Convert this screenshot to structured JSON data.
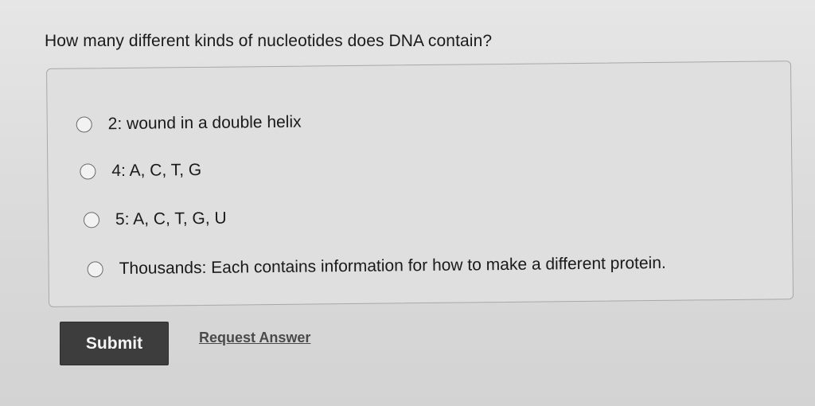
{
  "question": {
    "text": "How many different kinds of nucleotides does DNA contain?"
  },
  "options": [
    {
      "label": "2: wound in a double helix"
    },
    {
      "label": "4: A, C, T, G"
    },
    {
      "label": "5: A, C, T, G, U"
    },
    {
      "label": "Thousands: Each contains information for how to make a different protein."
    }
  ],
  "actions": {
    "submit_label": "Submit",
    "request_answer_label": "Request Answer"
  },
  "colors": {
    "background": "#dcdcdc",
    "submit_button": "#3d3d3d",
    "text": "#1c1c1c"
  }
}
